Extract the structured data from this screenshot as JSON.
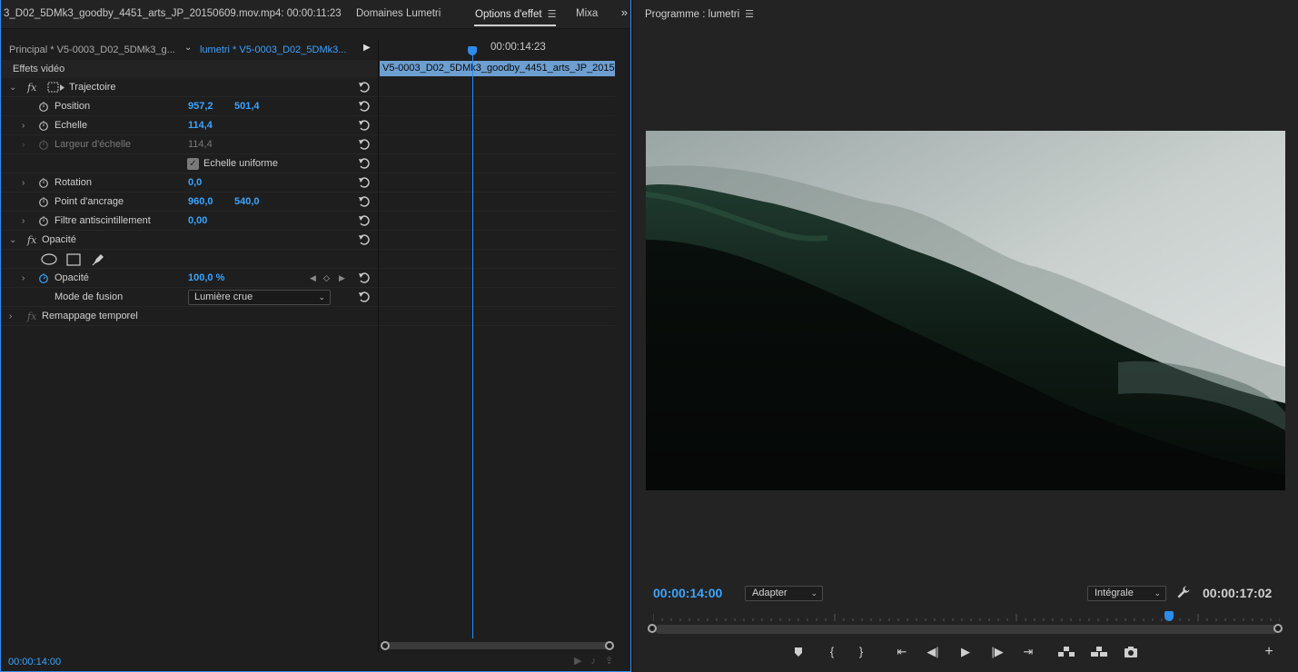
{
  "left_panel": {
    "tabs": [
      {
        "label": "3_D02_5DMk3_goodby_4451_arts_JP_20150609.mov.mp4: 00:00:11:23"
      },
      {
        "label": "Domaines Lumetri"
      },
      {
        "label": "Options d'effet"
      },
      {
        "label": "Mixa"
      }
    ],
    "sequence_tabs": {
      "master": "Principal * V5-0003_D02_5DMk3_g...",
      "sequence": "lumetri * V5-0003_D02_5DMk3..."
    },
    "section_header": "Effets vidéo",
    "trajectoire": {
      "label": "Trajectoire",
      "position": {
        "label": "Position",
        "x": "957,2",
        "y": "501,4"
      },
      "echelle": {
        "label": "Echelle",
        "value": "114,4"
      },
      "largeur": {
        "label": "Largeur d'échelle",
        "value": "114,4"
      },
      "uniforme": {
        "label": "Echelle uniforme",
        "checked": true
      },
      "rotation": {
        "label": "Rotation",
        "value": "0,0"
      },
      "ancrage": {
        "label": "Point d'ancrage",
        "x": "960,0",
        "y": "540,0"
      },
      "filtre": {
        "label": "Filtre antiscintillement",
        "value": "0,00"
      }
    },
    "opacite": {
      "label": "Opacité",
      "value_label": "Opacité",
      "value": "100,0 %",
      "fusion_label": "Mode de fusion",
      "fusion_value": "Lumière crue"
    },
    "remappage": {
      "label": "Remappage temporel"
    },
    "timeline": {
      "time": "00:00:14:23",
      "clip": "V5-0003_D02_5DMk3_goodby_4451_arts_JP_2015"
    },
    "status_time": "00:00:14:00"
  },
  "right_panel": {
    "title": "Programme : lumetri",
    "current_time": "00:00:14:00",
    "fit_select": "Adapter",
    "quality_select": "Intégrale",
    "duration": "00:00:17:02",
    "playhead_fraction": 0.825,
    "icons": [
      "marker-icon",
      "mark-in-icon",
      "mark-out-icon",
      "go-to-in-icon",
      "step-back-icon",
      "play-icon",
      "step-forward-icon",
      "go-to-out-icon",
      "lift-icon",
      "extract-icon",
      "export-frame-icon",
      "add-icon"
    ]
  },
  "colors": {
    "accent": "#2d8ceb",
    "value_blue": "#3aa5ff",
    "clip": "#6d9fd1"
  }
}
